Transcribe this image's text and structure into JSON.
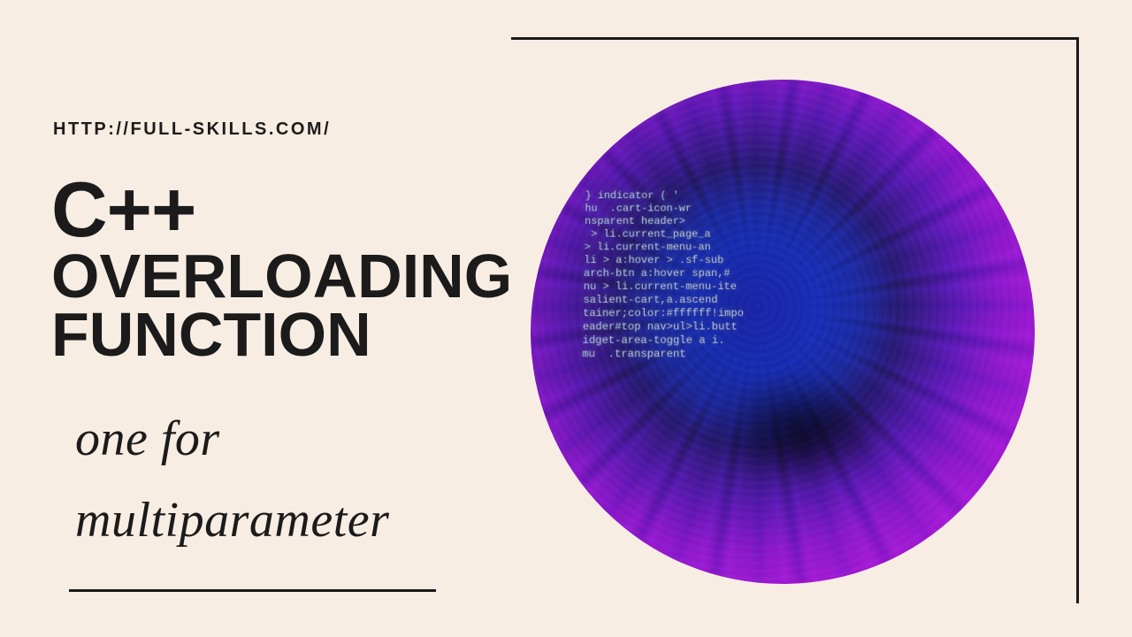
{
  "url": "HTTP://FULL-SKILLS.COM/",
  "title": {
    "line1": "C++",
    "line2": "OVERLOADING",
    "line3": "FUNCTION"
  },
  "script": {
    "line1": "one for",
    "line2": "multiparameter"
  },
  "image": {
    "description": "blurred vortex of blue and purple code",
    "code_lines": [
      "} indicator ( '",
      "hu  .cart-icon-wr",
      "nsparent header>",
      " > li.current_page_a",
      "> li.current-menu-an",
      "li > a:hover > .sf-sub",
      "arch-btn a:hover span,#",
      "nu > li.current-menu-ite",
      "salient-cart,a.ascend",
      "tainer;color:#ffffff!impo",
      "eader#top nav>ul>li.butt",
      "idget-area-toggle a i.",
      "mu  .transparent"
    ]
  }
}
